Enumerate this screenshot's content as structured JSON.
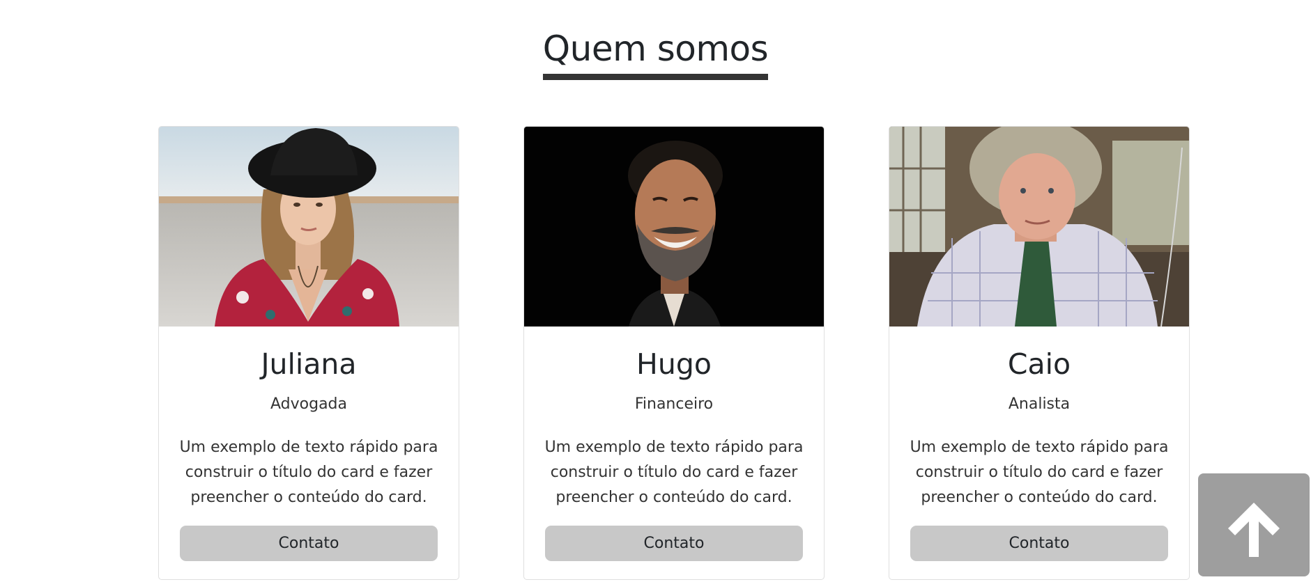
{
  "section": {
    "title": "Quem somos"
  },
  "cards": [
    {
      "name": "Juliana",
      "role": "Advogada",
      "text": "Um exemplo de texto rápido para construir o título do card e fazer preencher o conteúdo do card.",
      "button_label": "Contato",
      "photo": "woman-with-black-hat-portrait"
    },
    {
      "name": "Hugo",
      "role": "Financeiro",
      "text": "Um exemplo de texto rápido para construir o título do card e fazer preencher o conteúdo do card.",
      "button_label": "Contato",
      "photo": "smiling-bearded-man-portrait"
    },
    {
      "name": "Caio",
      "role": "Analista",
      "text": "Um exemplo de texto rápido para construir o título do card e fazer preencher o conteúdo do card.",
      "button_label": "Contato",
      "photo": "gray-haired-man-with-tie-portrait"
    }
  ],
  "back_to_top": {
    "icon": "arrow-up-icon"
  },
  "colors": {
    "button_bg": "#c8c8c8",
    "back_to_top_bg": "#9e9e9e",
    "title_underline": "#343434"
  }
}
